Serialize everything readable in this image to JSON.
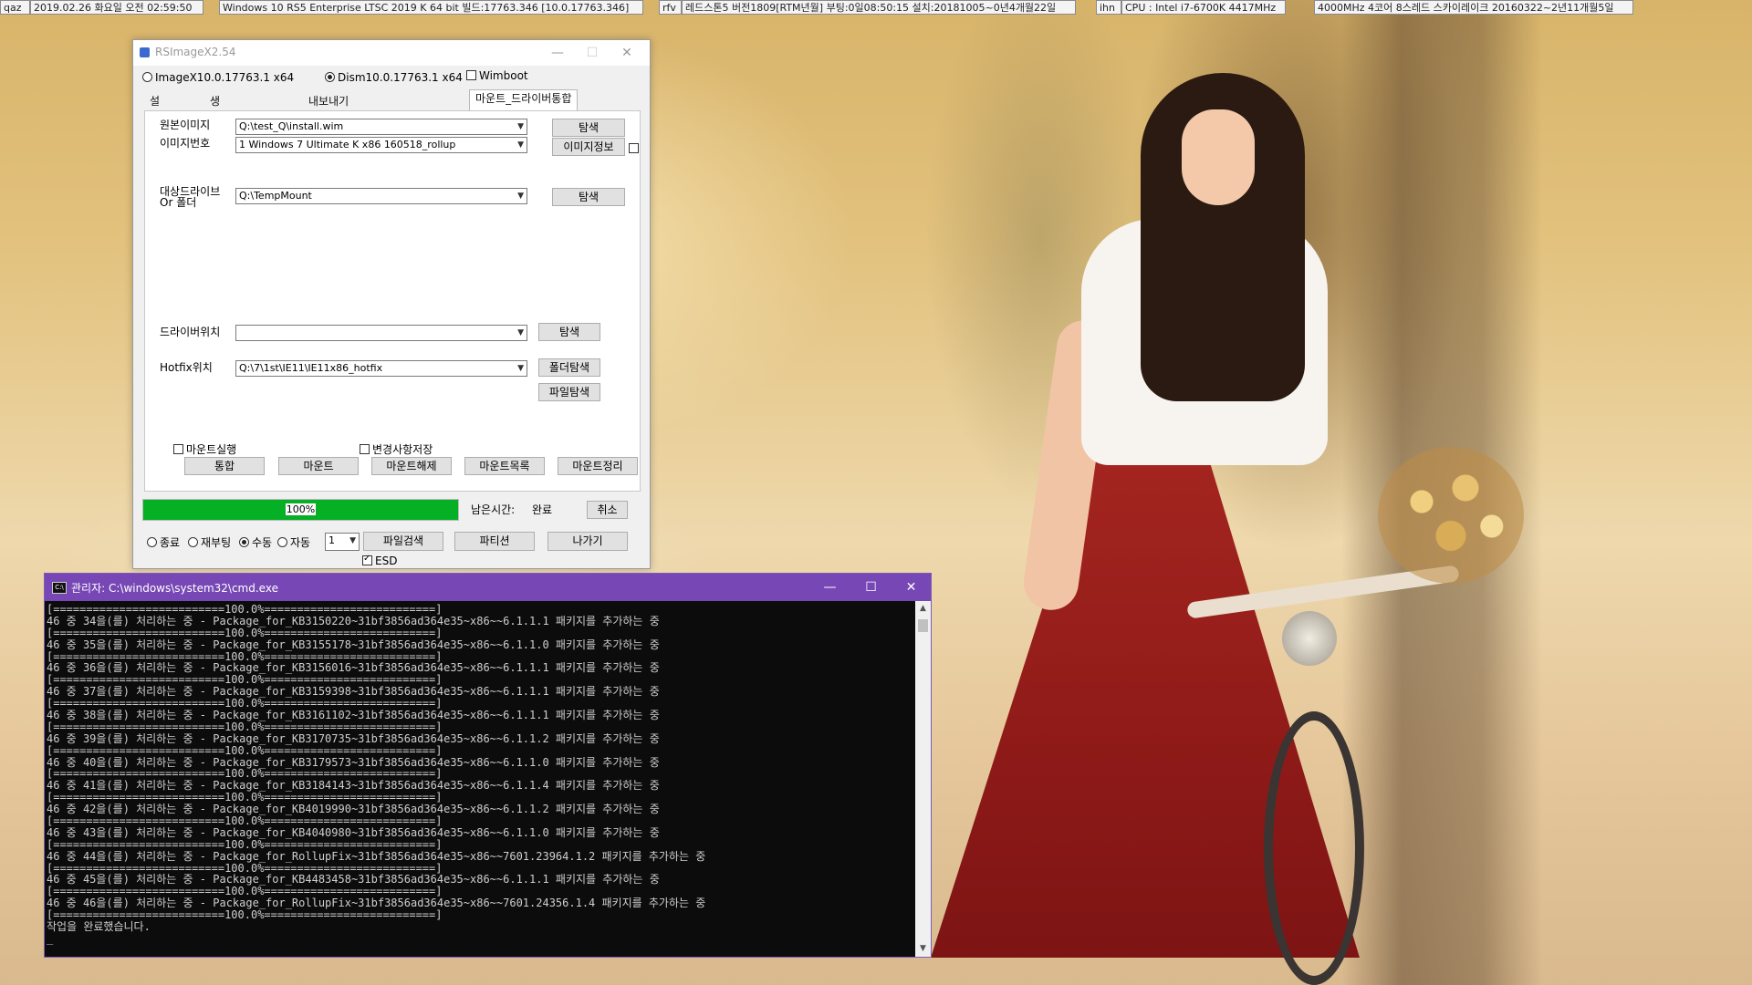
{
  "topbar": {
    "cells": [
      "qaz",
      "2019.02.26 화요일 오전 02:59:50",
      "Windows 10 RS5 Enterprise LTSC 2019 K 64 bit 빌드:17763.346 [10.0.17763.346]",
      "rfv",
      "레드스톤5 버전1809[RTM년월] 부팅:0일08:50:15 설치:20181005~0년4개월22일",
      "ihn",
      "CPU : Intel i7-6700K 4417MHz",
      "4000MHz 4코어 8스레드 스카이레이크 20160322~2년11개월5일"
    ]
  },
  "rsimage": {
    "title": "RSImageX2.54",
    "minimize": "—",
    "maximize": "☐",
    "close": "✕",
    "mode_options": [
      {
        "label": "ImageX10.0.17763.1 x64",
        "selected": false
      },
      {
        "label": "Dism10.0.17763.1 x64",
        "selected": true
      }
    ],
    "wimboot_label": "Wimboot",
    "tabs": [
      "설치_복원",
      "생성_이미지추가",
      "내보내기(esd<=>wim)_정보수정",
      "마운트_드라이버통합"
    ],
    "active_tab": 3,
    "source_image_label": "원본이미지",
    "source_image_value": "Q:\\test_Q\\install.wim",
    "image_index_label": "이미지번호",
    "image_index_value": "1  Windows 7 Ultimate K x86 160518_rollup",
    "target_label": "대상드라이브\nOr 폴더",
    "target_value": "Q:\\TempMount",
    "driver_label": "드라이버위치",
    "driver_value": "",
    "hotfix_label": "Hotfix위치",
    "hotfix_value": "Q:\\7\\1st\\IE11\\IE11x86_hotfix",
    "browse_label": "탐색",
    "image_info_label": "이미지정보",
    "folder_browse_label": "폴더탐색",
    "file_browse_label": "파일탐색",
    "actions": [
      "통합",
      "마운트",
      "마운트해제",
      "마운트목록",
      "마운트정리"
    ],
    "mount_run_label": "마운트실행",
    "save_changes_label": "변경사항저장",
    "progress_percent": 100,
    "progress_text": "100%",
    "remaining_label": "남은시간:",
    "remaining_value": "완료",
    "cancel_label": "취소",
    "after_options": [
      {
        "label": "종료",
        "selected": false
      },
      {
        "label": "재부팅",
        "selected": false
      },
      {
        "label": "수동",
        "selected": true
      },
      {
        "label": "자동",
        "selected": false
      }
    ],
    "count_value": "1",
    "file_search_label": "파일검색",
    "partition_label": "파티션",
    "exit_label": "나가기",
    "esd_label": "ESD"
  },
  "cmd": {
    "title": "관리자: C:\\windows\\system32\\cmd.exe",
    "icon_text": "C:\\",
    "minimize": "—",
    "maximize": "☐",
    "close": "✕",
    "lines": [
      "[==========================100.0%==========================]",
      "46 중 34을(를) 처리하는 중 - Package_for_KB3150220~31bf3856ad364e35~x86~~6.1.1.1 패키지를 추가하는 중",
      "[==========================100.0%==========================]",
      "46 중 35을(를) 처리하는 중 - Package_for_KB3155178~31bf3856ad364e35~x86~~6.1.1.0 패키지를 추가하는 중",
      "[==========================100.0%==========================]",
      "46 중 36을(를) 처리하는 중 - Package_for_KB3156016~31bf3856ad364e35~x86~~6.1.1.1 패키지를 추가하는 중",
      "[==========================100.0%==========================]",
      "46 중 37을(를) 처리하는 중 - Package_for_KB3159398~31bf3856ad364e35~x86~~6.1.1.1 패키지를 추가하는 중",
      "[==========================100.0%==========================]",
      "46 중 38을(를) 처리하는 중 - Package_for_KB3161102~31bf3856ad364e35~x86~~6.1.1.1 패키지를 추가하는 중",
      "[==========================100.0%==========================]",
      "46 중 39을(를) 처리하는 중 - Package_for_KB3170735~31bf3856ad364e35~x86~~6.1.1.2 패키지를 추가하는 중",
      "[==========================100.0%==========================]",
      "46 중 40을(를) 처리하는 중 - Package_for_KB3179573~31bf3856ad364e35~x86~~6.1.1.0 패키지를 추가하는 중",
      "[==========================100.0%==========================]",
      "46 중 41을(를) 처리하는 중 - Package_for_KB3184143~31bf3856ad364e35~x86~~6.1.1.4 패키지를 추가하는 중",
      "[==========================100.0%==========================]",
      "46 중 42을(를) 처리하는 중 - Package_for_KB4019990~31bf3856ad364e35~x86~~6.1.1.2 패키지를 추가하는 중",
      "[==========================100.0%==========================]",
      "46 중 43을(를) 처리하는 중 - Package_for_KB4040980~31bf3856ad364e35~x86~~6.1.1.0 패키지를 추가하는 중",
      "[==========================100.0%==========================]",
      "46 중 44을(를) 처리하는 중 - Package_for_RollupFix~31bf3856ad364e35~x86~~7601.23964.1.2 패키지를 추가하는 중",
      "[==========================100.0%==========================]",
      "46 중 45을(를) 처리하는 중 - Package_for_KB4483458~31bf3856ad364e35~x86~~6.1.1.1 패키지를 추가하는 중",
      "[==========================100.0%==========================]",
      "46 중 46을(를) 처리하는 중 - Package_for_RollupFix~31bf3856ad364e35~x86~~7601.24356.1.4 패키지를 추가하는 중",
      "[==========================100.0%==========================]",
      "작업을 완료했습니다."
    ],
    "prompt_cursor": "_"
  },
  "colors": {
    "progress_fill": "#06b025",
    "cmd_titlebar": "#7747b5",
    "cmd_background": "#0c0c0c"
  }
}
